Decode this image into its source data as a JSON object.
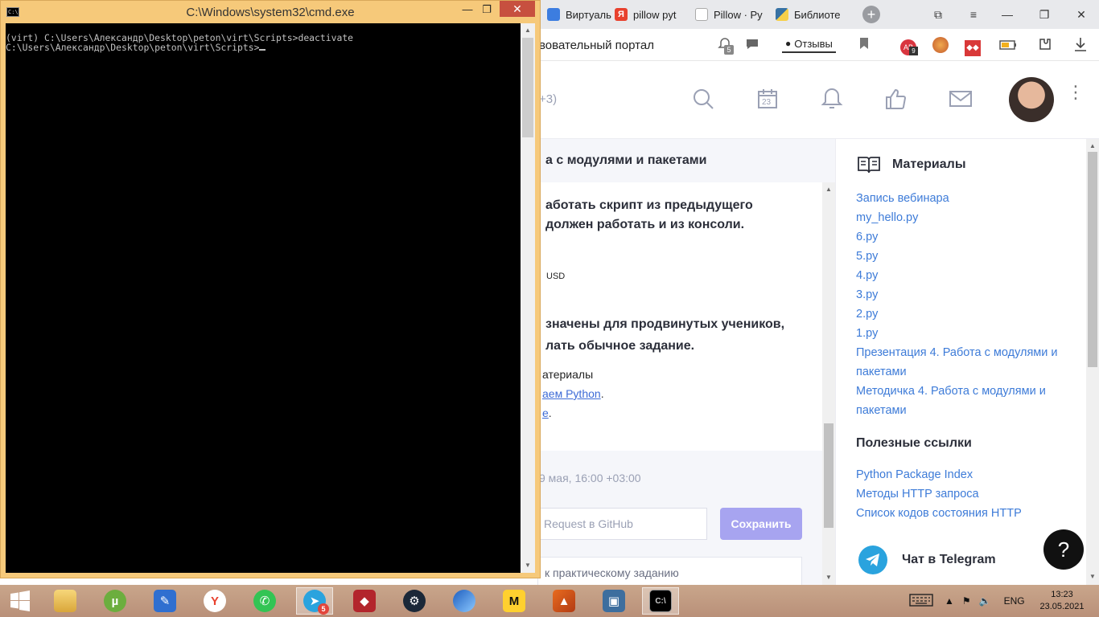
{
  "browser": {
    "tabs": [
      {
        "label": "Виртуаль",
        "icon": "virtual-icon",
        "color": "#3c7de0"
      },
      {
        "label": "pillow pyt",
        "icon": "yandex-icon",
        "color": "#e8412e"
      },
      {
        "label": "Pillow · Py",
        "icon": "pillow-icon",
        "color": "#ffffff"
      },
      {
        "label": "Библиоте",
        "icon": "python-icon",
        "color": "#3772a4"
      }
    ],
    "new_tab": "+",
    "address_title": "вовательный портал",
    "reviews_label": "Отзывы",
    "badges": {
      "notify_count": "5",
      "ext_count": "9"
    }
  },
  "site": {
    "header_count": "+3)",
    "calendar_day": "23",
    "more": "⋮"
  },
  "lesson": {
    "title": "а с модулями и пакетами",
    "line1": "аботать скрипт из предыдущего",
    "line2": " должен работать и из консоли.",
    "currency": "USD",
    "line3": "значены для продвинутых учеников,",
    "line4": "лать обычное задание.",
    "materials": "атериалы",
    "link1": "аем Python",
    "link1_tail": ".",
    "link2": "e",
    "link2_tail": ".",
    "date": "9 мая, 16:00 +03:00",
    "pr_placeholder": "Request в GitHub",
    "save_label": "Сохранить",
    "practice_link": "к практическому заданию"
  },
  "sidebar": {
    "materials_title": "Материалы",
    "materials": [
      "Запись вебинара",
      "my_hello.py",
      "6.py",
      "5.py",
      "4.py",
      "3.py",
      "2.py",
      "1.py",
      "Презентация 4. Работа с модулями и",
      "пакетами",
      "Методичка 4. Работа с модулями и",
      "пакетами"
    ],
    "useful_title": "Полезные ссылки",
    "useful_links": [
      "Python Package Index",
      "Методы HTTP запроса",
      "Список кодов состояния HTTP"
    ],
    "telegram_label": "Чат в Telegram",
    "help": "?"
  },
  "cmd": {
    "title": "C:\\Windows\\system32\\cmd.exe",
    "icon_text": "C:\\",
    "lines": [
      "(virt) C:\\Users\\Александр\\Desktop\\peton\\virt\\Scripts>deactivate",
      "C:\\Users\\Александр\\Desktop\\peton\\virt\\Scripts>"
    ],
    "minimize": "—",
    "maximize": "❐",
    "close": "✕"
  },
  "taskbar": {
    "telegram_badge": "5",
    "language": "ENG",
    "time": "13:23",
    "date": "23.05.2021"
  },
  "colors": {
    "cmd_frame": "#f6c97a",
    "link_blue": "#3d7bd8",
    "save_button": "#a7a4f0",
    "telegram_blue": "#2aa3de"
  }
}
